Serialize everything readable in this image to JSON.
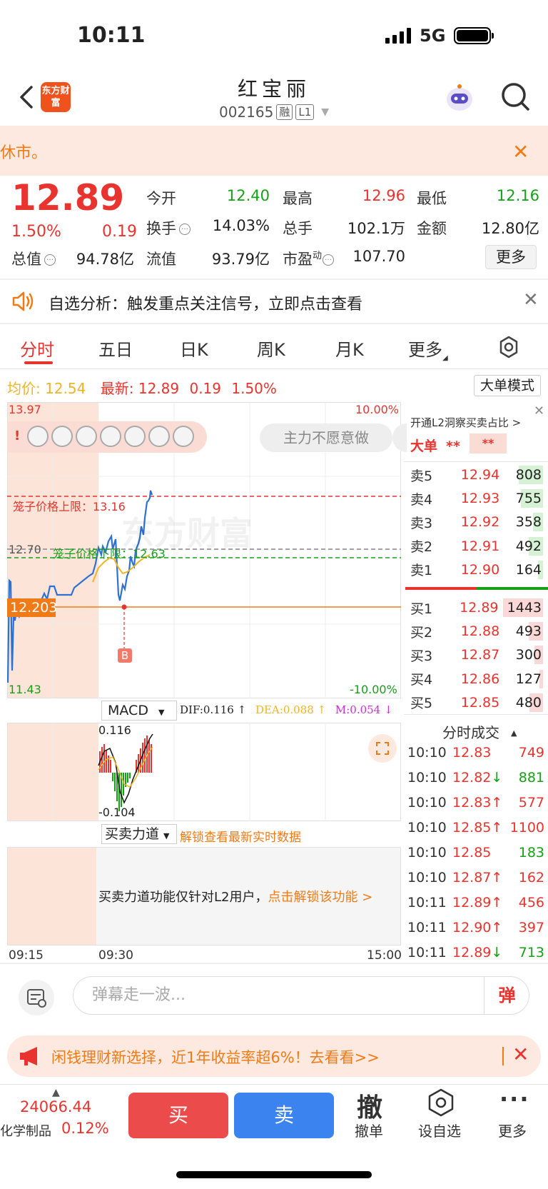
{
  "status_bar": {
    "time": "10:11",
    "network": "5G"
  },
  "header": {
    "logo_text": "东方财富",
    "title": "红宝丽",
    "code": "002165",
    "tag1": "融",
    "tag2": "L1"
  },
  "notice": {
    "text": "休市。"
  },
  "quote": {
    "price": "12.89",
    "change_pct": "1.50%",
    "change": "0.19",
    "open_label": "今开",
    "open": "12.40",
    "high_label": "最高",
    "high": "12.96",
    "low_label": "最低",
    "low": "12.16",
    "turnover_label": "换手",
    "turnover": "14.03%",
    "volume_label": "总手",
    "volume": "102.1万",
    "amount_label": "金额",
    "amount": "12.80亿",
    "mktcap_label": "总值",
    "mktcap": "94.78亿",
    "float_label": "流值",
    "float": "93.79亿",
    "pe_label": "市盈",
    "pe_sup": "动",
    "pe": "107.70",
    "more": "更多"
  },
  "analysis": {
    "text": "自选分析：触发重点关注信号，立即点击查看"
  },
  "tabs": [
    "分时",
    "五日",
    "日K",
    "周K",
    "月K",
    "更多"
  ],
  "chart": {
    "avg_label": "均价:",
    "avg": "12.54",
    "latest_label": "最新:",
    "latest": "12.89",
    "latest_change": "0.19",
    "latest_pct": "1.50%",
    "big_mode": "大单模式",
    "y_top": "13.97",
    "y_top_pct": "10.00%",
    "y_bottom": "11.43",
    "y_bottom_pct": "-10.00%",
    "y_mid": "12.70",
    "cross_price": "12.203",
    "cage_upper": "笼子价格上限：13.16",
    "cage_lower": "笼子价格下限：12.63",
    "buy_marker": "B",
    "bubble": "主力不愿意做",
    "watermark": "东方财富",
    "colors": {
      "price_line": "#2d72d2",
      "avg_line": "#f0b324",
      "up": "#e8332e",
      "down": "#16a017"
    }
  },
  "macd": {
    "select": "MACD",
    "dif": "DIF:0.116 ↑",
    "dea": "DEA:0.088 ↑",
    "m": "M:0.054 ↓",
    "top": "0.116",
    "bottom": "-0.104"
  },
  "force": {
    "select": "买卖力道",
    "unlock": "解锁查看最新实时数据",
    "msg": "买卖力道功能仅针对L2用户，",
    "msg_link": "点击解锁该功能 >"
  },
  "time_axis": [
    "09:15",
    "09:30",
    "15:00"
  ],
  "order_book": {
    "l2_text": "开通L2洞察买卖占比 >",
    "big_label": "大单",
    "big_val1": "**",
    "big_val2": "**",
    "asks": [
      {
        "label": "卖5",
        "price": "12.94",
        "vol": "808",
        "fill": 0.6
      },
      {
        "label": "卖4",
        "price": "12.93",
        "vol": "755",
        "fill": 0.55
      },
      {
        "label": "卖3",
        "price": "12.92",
        "vol": "358",
        "fill": 0.25
      },
      {
        "label": "卖2",
        "price": "12.91",
        "vol": "492",
        "fill": 0.35
      },
      {
        "label": "卖1",
        "price": "12.90",
        "vol": "164",
        "fill": 0.12
      }
    ],
    "bids": [
      {
        "label": "买1",
        "price": "12.89",
        "vol": "1443",
        "fill": 1.0
      },
      {
        "label": "买2",
        "price": "12.88",
        "vol": "493",
        "fill": 0.35
      },
      {
        "label": "买3",
        "price": "12.87",
        "vol": "300",
        "fill": 0.22
      },
      {
        "label": "买4",
        "price": "12.86",
        "vol": "127",
        "fill": 0.09
      },
      {
        "label": "买5",
        "price": "12.85",
        "vol": "480",
        "fill": 0.34
      }
    ]
  },
  "trades": {
    "title": "分时成交",
    "rows": [
      {
        "time": "10:10",
        "price": "12.83",
        "arrow": "",
        "vol": "749",
        "pc": "red",
        "vc": "red"
      },
      {
        "time": "10:10",
        "price": "12.82",
        "arrow": "↓",
        "vol": "881",
        "pc": "red",
        "vc": "green"
      },
      {
        "time": "10:10",
        "price": "12.83",
        "arrow": "↑",
        "vol": "577",
        "pc": "red",
        "vc": "red"
      },
      {
        "time": "10:10",
        "price": "12.85",
        "arrow": "↑",
        "vol": "1100",
        "pc": "red",
        "vc": "red"
      },
      {
        "time": "10:10",
        "price": "12.85",
        "arrow": "",
        "vol": "183",
        "pc": "red",
        "vc": "green"
      },
      {
        "time": "10:10",
        "price": "12.87",
        "arrow": "↑",
        "vol": "162",
        "pc": "red",
        "vc": "red"
      },
      {
        "time": "10:11",
        "price": "12.89",
        "arrow": "↑",
        "vol": "456",
        "pc": "red",
        "vc": "red"
      },
      {
        "time": "10:11",
        "price": "12.90",
        "arrow": "↑",
        "vol": "397",
        "pc": "red",
        "vc": "red"
      },
      {
        "time": "10:11",
        "price": "12.89",
        "arrow": "↓",
        "vol": "713",
        "pc": "red",
        "vc": "green"
      }
    ]
  },
  "comment": {
    "placeholder": "弹幕走一波...",
    "danmu": "弹"
  },
  "ad": {
    "text": "闲钱理财新选择，近1年收益率超6%！去看看>>"
  },
  "bottom": {
    "index_val": "24066.44",
    "index_name": "化学制品",
    "index_pct": "0.12%",
    "buy": "买",
    "sell": "卖",
    "cancel_big": "撤",
    "cancel": "撤单",
    "fav": "设自选",
    "more": "更多"
  }
}
